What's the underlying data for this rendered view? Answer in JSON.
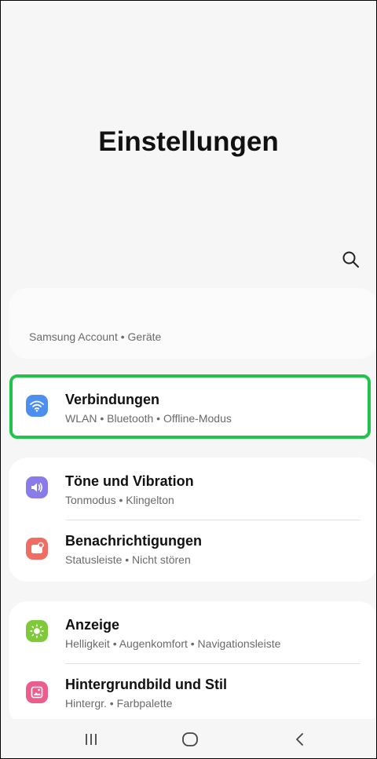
{
  "page": {
    "title": "Einstellungen"
  },
  "account": {
    "subtitle": "Samsung Account • Geräte"
  },
  "items": [
    {
      "title": "Verbindungen",
      "subtitle": "WLAN • Bluetooth • Offline-Modus",
      "icon": "wifi-icon",
      "color": "#4d8ff0"
    },
    {
      "title": "Töne und Vibration",
      "subtitle": "Tonmodus • Klingelton",
      "icon": "speaker-icon",
      "color": "#8a7bea"
    },
    {
      "title": "Benachrichtigungen",
      "subtitle": "Statusleiste • Nicht stören",
      "icon": "notification-icon",
      "color": "#ef6d62"
    },
    {
      "title": "Anzeige",
      "subtitle": "Helligkeit • Augenkomfort • Navigationsleiste",
      "icon": "sun-icon",
      "color": "#80c93a"
    },
    {
      "title": "Hintergrundbild und Stil",
      "subtitle": "Hintergr. • Farbpalette",
      "icon": "image-icon",
      "color": "#ea5d8c"
    }
  ],
  "colors": {
    "highlight": "#21c44a"
  }
}
